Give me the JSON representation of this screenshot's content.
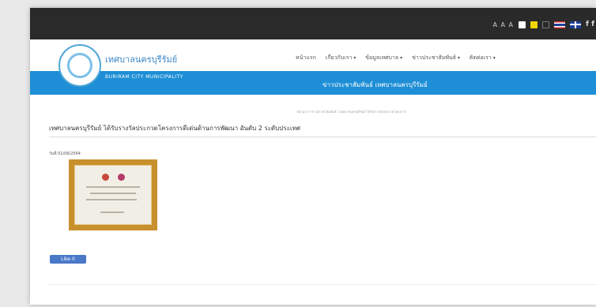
{
  "topbar": {
    "font_size_label": "A A A",
    "contrast_colors": [
      "#ffffff",
      "#f2d600",
      "#2a2a2a"
    ],
    "languages": [
      "th-flag-icon",
      "en-flag-icon"
    ],
    "social": "f f"
  },
  "header": {
    "site_title": "เทศบาลนครบุรีรัมย์",
    "site_subtitle": "BURIRAM CITY MUNICIPALITY",
    "nav": [
      {
        "label": "หน้าแรก",
        "has_menu": false
      },
      {
        "label": "เกี่ยวกับเรา",
        "has_menu": true
      },
      {
        "label": "ข้อมูลเทศบาล",
        "has_menu": true
      },
      {
        "label": "ข่าวประชาสัมพันธ์",
        "has_menu": true
      },
      {
        "label": "ติดต่อเรา",
        "has_menu": true
      }
    ],
    "ticker": "ข่าวประชาสัมพันธ์ เทศบาลนครบุรีรัมย์"
  },
  "content": {
    "breadcrumb": "หน้าแรก / ข่าวประชาสัมพันธ์ / เทศบาลนครบุรีรัมย์ ได้รับรางวัลประกวดโครงการ",
    "heading": "เทศบาลนครบุรีรัมย์ ได้รับรางวัลประกวดโครงการดีเด่นด้านการพัฒนา อันดับ 2 ระดับประเทศ",
    "post_date": "วันที่ 01/06/2564",
    "like_label": "Like 0"
  },
  "colors": {
    "topbar": "#2a2a2a",
    "brand_blue": "#1e8fd6",
    "frame_gold": "#c8902c"
  }
}
